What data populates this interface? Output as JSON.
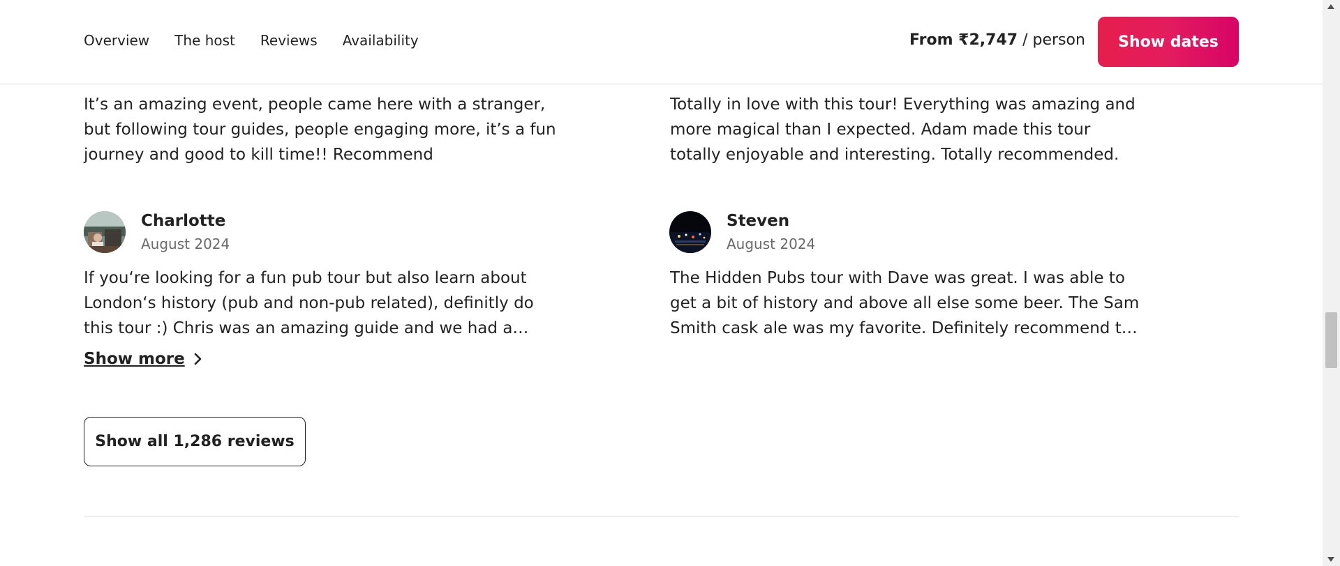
{
  "header": {
    "tabs": [
      {
        "label": "Overview"
      },
      {
        "label": "The host"
      },
      {
        "label": "Reviews"
      },
      {
        "label": "Availability"
      }
    ],
    "price_prefix": "From ",
    "price_amount": "₹2,747",
    "price_unit": " / person",
    "cta_label": "Show dates",
    "accent_color": "#e31c5f"
  },
  "reviews": {
    "top_left_text": "It’s an amazing event, people came here with a stranger, but following tour guides, people engaging more, it’s a fun journey and good to kill time!! Recommend",
    "top_right_text": "Totally in love with this tour! Everything was amazing and more magical than I expected. Adam made this tour totally enjoyable and interesting. Totally recommended.",
    "items": [
      {
        "name": "Charlotte",
        "date": "August 2024",
        "text": "If you‘re looking for a fun pub tour but also learn about London‘s history (pub and non-pub related), definitly do this tour :) Chris was an amazing guide and we had a great time and learned so much",
        "avatar": "photo-avatar"
      },
      {
        "name": "Steven",
        "date": "August 2024",
        "text": "The Hidden Pubs tour with Dave was great. I was able to get a bit of history and above all else some beer. The Sam Smith cask ale was my favorite. Definitely recommend this tour",
        "avatar": "night-city-avatar"
      }
    ],
    "show_more_label": "Show more",
    "show_all_label": "Show all 1,286 reviews"
  }
}
